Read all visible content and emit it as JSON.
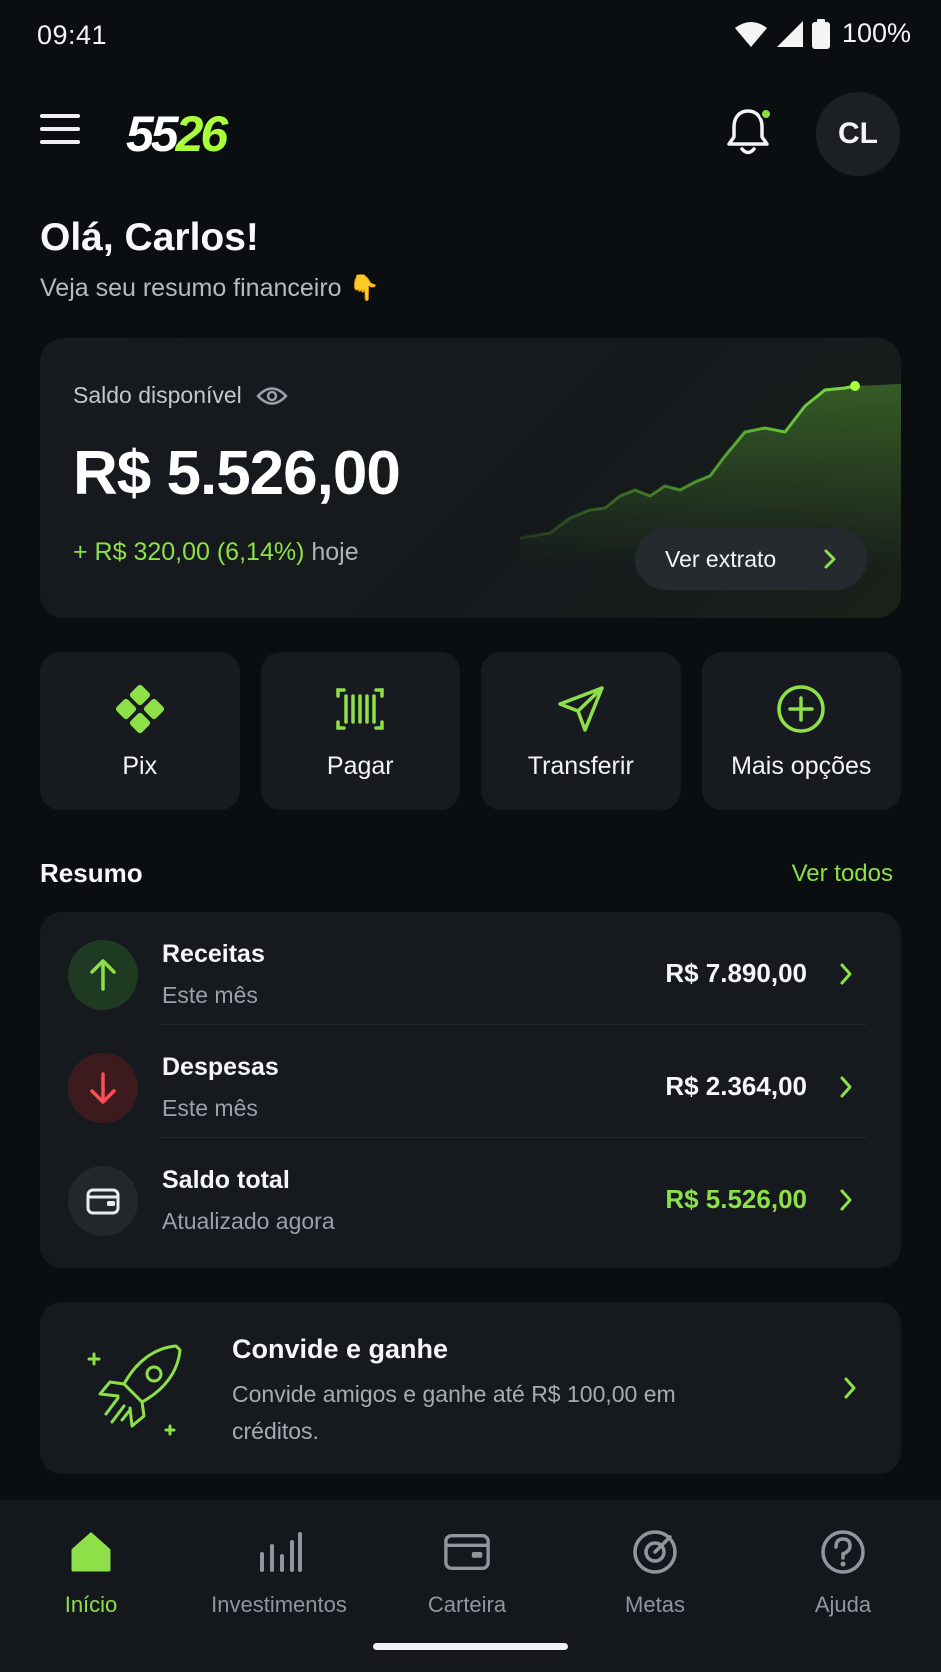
{
  "status": {
    "time": "09:41",
    "battery": "100%"
  },
  "header": {
    "logo_white": "55",
    "logo_green": "26",
    "avatar_initials": "CL"
  },
  "greeting": {
    "title": "Olá, Carlos!",
    "subtitle": "Veja seu resumo financeiro 👇"
  },
  "balance": {
    "label": "Saldo disponível",
    "value": "R$ 5.526,00",
    "change": "+ R$ 320,00 (6,14%)",
    "change_suffix": "hoje",
    "extract_button": "Ver extrato"
  },
  "actions": [
    {
      "label": "Pix",
      "icon": "pix-icon"
    },
    {
      "label": "Pagar",
      "icon": "barcode-icon"
    },
    {
      "label": "Transferir",
      "icon": "send-icon"
    },
    {
      "label": "Mais opções",
      "icon": "plus-circle-icon"
    }
  ],
  "summary": {
    "title": "Resumo",
    "see_all": "Ver todos",
    "rows": [
      {
        "title": "Receitas",
        "subtitle": "Este mês",
        "amount": "R$ 7.890,00",
        "icon": "arrow-up-icon"
      },
      {
        "title": "Despesas",
        "subtitle": "Este mês",
        "amount": "R$ 2.364,00",
        "icon": "arrow-down-icon"
      },
      {
        "title": "Saldo total",
        "subtitle": "Atualizado agora",
        "amount": "R$ 5.526,00",
        "icon": "wallet-icon"
      }
    ]
  },
  "invite": {
    "title": "Convide e ganhe",
    "description": "Convide amigos e ganhe até R$ 100,00 em créditos."
  },
  "nav": [
    {
      "label": "Início",
      "icon": "home-icon",
      "active": true
    },
    {
      "label": "Investimentos",
      "icon": "bar-chart-icon",
      "active": false
    },
    {
      "label": "Carteira",
      "icon": "card-icon",
      "active": false
    },
    {
      "label": "Metas",
      "icon": "target-icon",
      "active": false
    },
    {
      "label": "Ajuda",
      "icon": "help-icon",
      "active": false
    }
  ],
  "colors": {
    "accent": "#8ee048",
    "logo_accent": "#a8ff3a",
    "negative": "#e5484d",
    "background": "#0b0e11",
    "card": "#161a1e"
  }
}
